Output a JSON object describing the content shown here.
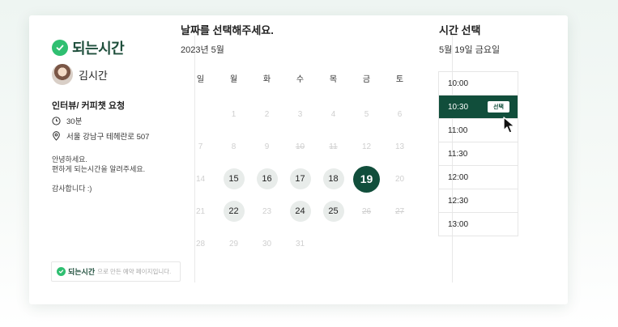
{
  "brand": {
    "name": "되는시간",
    "accent": "#2fbf71",
    "dark": "#114e3b"
  },
  "host": {
    "name": "김시간"
  },
  "event": {
    "title": "인터뷰/ 커피챗 요청",
    "duration": "30분",
    "location": "서울 강남구 테헤란로 507",
    "description_lines": [
      "안녕하세요.",
      "편하게 되는시간을 알려주세요.",
      "감사합니다 :)"
    ]
  },
  "footer": {
    "brand": "되는시간",
    "text": "으로 만든 예약 페이지입니다."
  },
  "calendar": {
    "title": "날짜를 선택해주세요.",
    "month_label": "2023년 5월",
    "weekdays": [
      "일",
      "월",
      "화",
      "수",
      "목",
      "금",
      "토"
    ],
    "days": [
      {
        "label": "",
        "state": "empty"
      },
      {
        "label": "1",
        "state": "disabled"
      },
      {
        "label": "2",
        "state": "disabled"
      },
      {
        "label": "3",
        "state": "disabled"
      },
      {
        "label": "4",
        "state": "disabled"
      },
      {
        "label": "5",
        "state": "disabled"
      },
      {
        "label": "6",
        "state": "disabled"
      },
      {
        "label": "7",
        "state": "disabled"
      },
      {
        "label": "8",
        "state": "disabled"
      },
      {
        "label": "9",
        "state": "disabled"
      },
      {
        "label": "10",
        "state": "struck"
      },
      {
        "label": "11",
        "state": "struck"
      },
      {
        "label": "12",
        "state": "disabled"
      },
      {
        "label": "13",
        "state": "disabled"
      },
      {
        "label": "14",
        "state": "disabled"
      },
      {
        "label": "15",
        "state": "available"
      },
      {
        "label": "16",
        "state": "available"
      },
      {
        "label": "17",
        "state": "available"
      },
      {
        "label": "18",
        "state": "available"
      },
      {
        "label": "19",
        "state": "selected"
      },
      {
        "label": "20",
        "state": "disabled"
      },
      {
        "label": "21",
        "state": "disabled"
      },
      {
        "label": "22",
        "state": "available"
      },
      {
        "label": "23",
        "state": "disabled"
      },
      {
        "label": "24",
        "state": "available"
      },
      {
        "label": "25",
        "state": "available"
      },
      {
        "label": "26",
        "state": "struck"
      },
      {
        "label": "27",
        "state": "struck"
      },
      {
        "label": "28",
        "state": "disabled"
      },
      {
        "label": "29",
        "state": "disabled"
      },
      {
        "label": "30",
        "state": "disabled"
      },
      {
        "label": "31",
        "state": "disabled"
      }
    ]
  },
  "time_panel": {
    "title": "시간 선택",
    "date_label": "5월 19일 금요일",
    "select_label": "선택",
    "slots": [
      {
        "time": "10:00",
        "active": false
      },
      {
        "time": "10:30",
        "active": true
      },
      {
        "time": "11:00",
        "active": false
      },
      {
        "time": "11:30",
        "active": false
      },
      {
        "time": "12:00",
        "active": false
      },
      {
        "time": "12:30",
        "active": false
      },
      {
        "time": "13:00",
        "active": false
      }
    ]
  }
}
